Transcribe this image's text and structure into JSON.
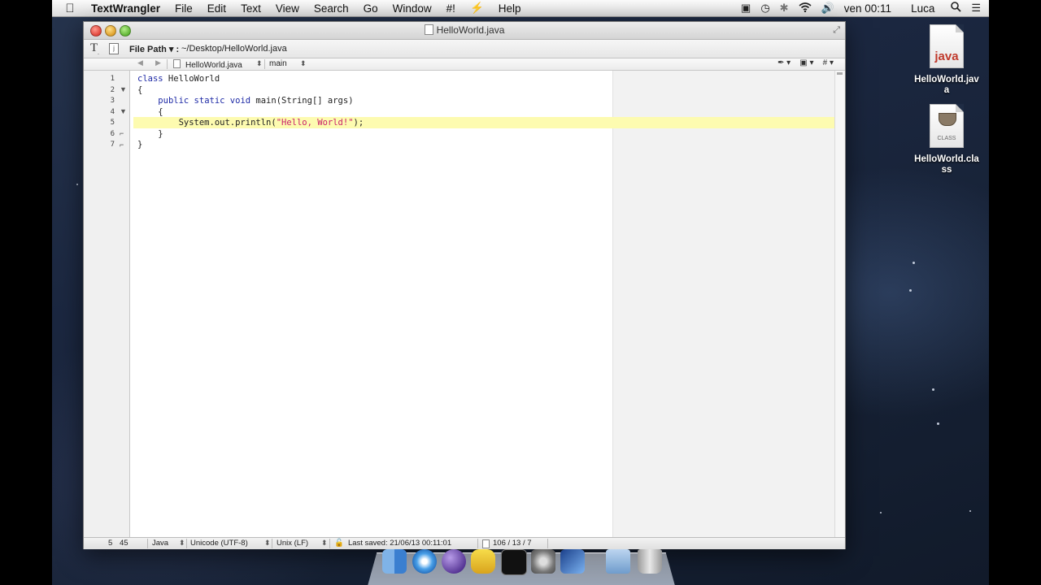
{
  "menubar": {
    "apple_glyph": "",
    "app_name": "TextWrangler",
    "items": [
      "File",
      "Edit",
      "Text",
      "View",
      "Search",
      "Go",
      "Window",
      "#!",
      "⚡",
      "Help"
    ],
    "clock": "ven 00:11",
    "user": "Luca",
    "status_icons": [
      "facetime-camera-icon",
      "time-machine-icon",
      "bluetooth-icon",
      "wifi-icon",
      "volume-icon"
    ]
  },
  "window": {
    "title": "HelloWorld.java",
    "path_label": "File Path ▾ :",
    "path_value": "~/Desktop/HelloWorld.java",
    "nav": {
      "file": "HelloWorld.java",
      "function": "main",
      "updown_glyph": "⬍"
    },
    "line_numbers": [
      "1",
      "2",
      "3",
      "4",
      "5",
      "6",
      "7"
    ],
    "fold_marks": [
      "",
      "▼",
      "",
      "▼",
      "",
      "⌐",
      "⌐"
    ],
    "code": {
      "l1_kw": "class",
      "l1_rest": " HelloWorld",
      "l2": "{",
      "l3_indent": "    ",
      "l3_kw": "public static void",
      "l3_rest": " main(String[] args)",
      "l4": "    {",
      "l5_pre": "        System.out.println(",
      "l5_str": "\"Hello, World!\"",
      "l5_post": ");",
      "l6": "    }",
      "l7": "}"
    },
    "status": {
      "line": "5",
      "col": "45",
      "language": "Java",
      "encoding": "Unicode (UTF-8)",
      "line_endings": "Unix (LF)",
      "last_saved": "Last saved: 21/06/13 00:11:01",
      "counts": "106 / 13 / 7"
    }
  },
  "desktop": {
    "icons": [
      {
        "label": "HelloWorld.java",
        "ext": "java"
      },
      {
        "label": "HelloWorld.class",
        "ext": "CLASS"
      }
    ]
  },
  "dock": {
    "items": [
      "finder-icon",
      "safari-icon",
      "eclipse-icon",
      "textwrangler-icon",
      "terminal-icon",
      "system-preferences-icon",
      "imovie-icon",
      "downloads-icon",
      "trash-icon"
    ]
  }
}
